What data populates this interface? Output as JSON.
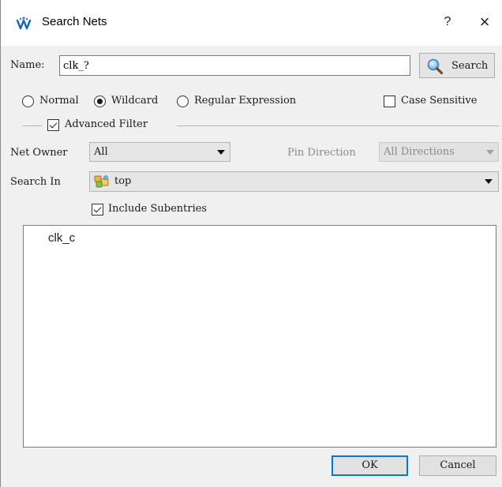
{
  "window": {
    "title": "Search Nets",
    "help_label": "?",
    "close_label": "×"
  },
  "name_row": {
    "label": "Name:",
    "value": "clk_?",
    "search_button": "Search"
  },
  "match_mode": {
    "options": [
      "Normal",
      "Wildcard",
      "Regular Expression"
    ],
    "selected": "Wildcard",
    "case_sensitive_label": "Case Sensitive",
    "case_sensitive_checked": false
  },
  "advanced": {
    "label": "Advanced Filter",
    "checked": true,
    "net_owner_label": "Net Owner",
    "net_owner_value": "All",
    "pin_direction_label": "Pin Direction",
    "pin_direction_value": "All Directions",
    "pin_direction_enabled": false,
    "search_in_label": "Search In",
    "search_in_value": "top",
    "include_subentries_label": "Include Subentries",
    "include_subentries_checked": true
  },
  "results": [
    "clk_c"
  ],
  "footer": {
    "ok_label": "OK",
    "cancel_label": "Cancel"
  },
  "colors": {
    "dialog_bg": "#f0f0f0",
    "default_button_border": "#0078d7",
    "disabled_text": "#8a8a8a"
  },
  "icons": {
    "app": "gowin-logo-icon",
    "search": "magnifier-icon",
    "module": "module-hierarchy-icon"
  }
}
